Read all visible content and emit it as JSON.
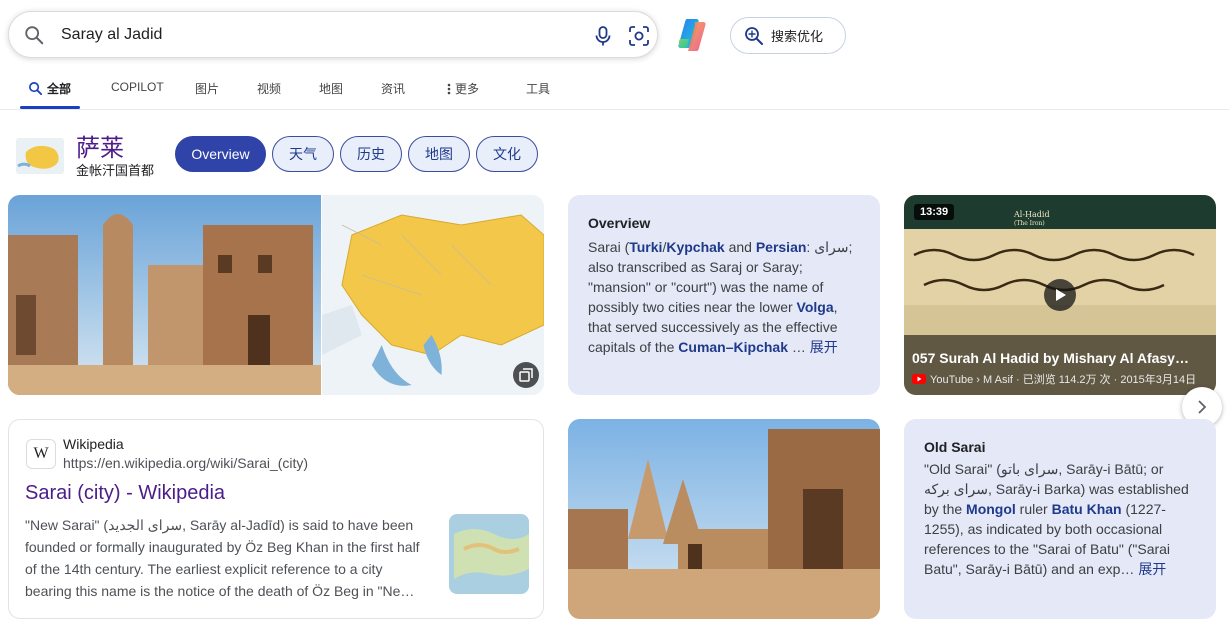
{
  "search": {
    "query": "Saray al Jadid",
    "optimize_label": "搜索优化"
  },
  "tabs": [
    {
      "label": "全部"
    },
    {
      "label": "COPILOT"
    },
    {
      "label": "图片"
    },
    {
      "label": "视频"
    },
    {
      "label": "地图"
    },
    {
      "label": "资讯"
    },
    {
      "label": "更多"
    },
    {
      "label": "工具"
    }
  ],
  "entity": {
    "title": "萨莱",
    "subtitle": "金帐汗国首都",
    "pills": [
      "Overview",
      "天气",
      "历史",
      "地图",
      "文化"
    ]
  },
  "overview": {
    "heading": "Overview",
    "t1": "Sarai (",
    "l1": "Turki",
    "t2": "/",
    "l2": "Kypchak",
    "t3": " and ",
    "l3": "Persian",
    "t4": ": سرای; also transcribed as Saraj or Saray; \"mansion\" or \"court\") was the name of possibly two cities near the lower ",
    "l4": "Volga",
    "t5": ", that served successively as the effective capitals of the ",
    "l5": "Cuman–Kipchak",
    "t6": " … ",
    "more": "展开"
  },
  "video": {
    "duration": "13:39",
    "title": "057 Surah Al Hadid by Mishary Al Afasy…",
    "meta": "YouTube › M Asif · 已浏览 114.2万 次 · 2015年3月14日"
  },
  "wiki": {
    "site": "Wikipedia",
    "url": "https://en.wikipedia.org/wiki/Sarai_(city)",
    "title": "Sarai (city) - Wikipedia",
    "snippet": "\"New Sarai\" (سرای الجدید, Sarāy al-Jadīd) is said to have been founded or formally inaugurated by Öz Beg Khan in the first half of the 14th century. The earliest explicit reference to a city bearing this name is the notice of the death of Öz Beg in \"Ne…"
  },
  "old_sarai": {
    "heading": "Old Sarai",
    "t1": "\"Old Sarai\" (سرای باتو, Sarāy-i Bātū; or سرای برکه, Sarāy-i Barka) was established by the ",
    "l1": "Mongol",
    "t2": " ruler ",
    "l2": "Batu Khan",
    "t3": " (1227-1255), as indicated by both occasional references to the \"Sarai of Batu\" (\"Sarai Batu\", Sarāy-i Bātū) and an exp… ",
    "more": "展开"
  },
  "colors": {
    "accent": "#2f43a8",
    "link": "#1f3a8a",
    "visited_title": "#4b1c8a",
    "card_bg": "#e4e8f7"
  },
  "icons": [
    "search-icon",
    "microphone-icon",
    "camera-lens-icon",
    "copilot-logo",
    "search-optimize-icon",
    "more-dots-icon",
    "expand-gallery-icon",
    "play-icon",
    "youtube-icon",
    "chevron-right-icon",
    "wikipedia-icon"
  ]
}
